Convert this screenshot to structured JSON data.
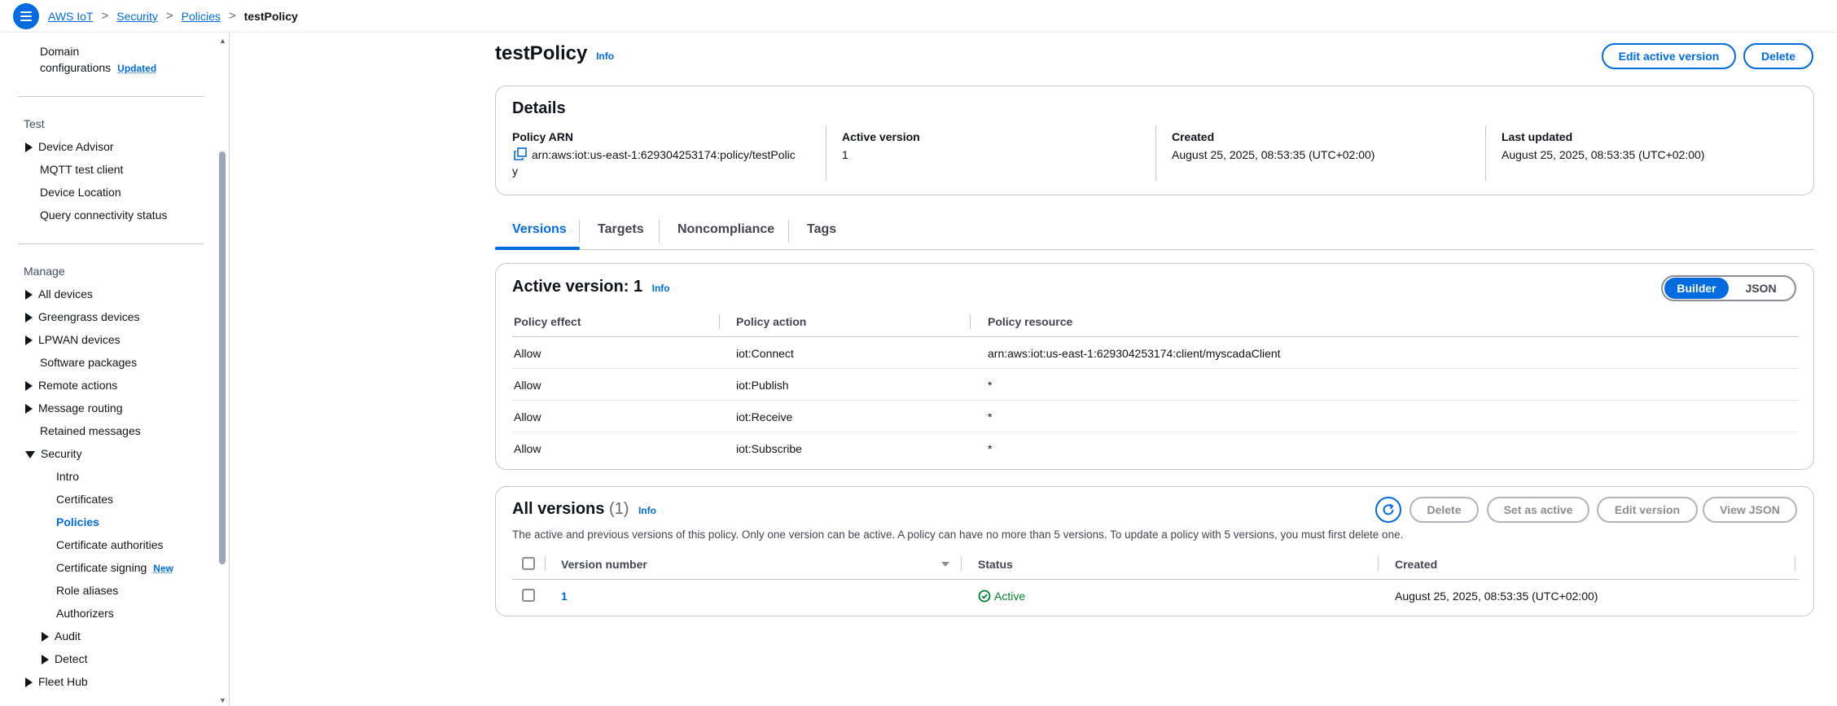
{
  "breadcrumb": {
    "items": [
      "AWS IoT",
      "Security",
      "Policies"
    ],
    "current": "testPolicy",
    "separator": ">"
  },
  "sidebar": {
    "domain_config_line1": "Domain",
    "domain_config_line2": "configurations",
    "domain_config_badge": "Updated",
    "test_heading": "Test",
    "test_items": [
      "Device Advisor",
      "MQTT test client",
      "Device Location",
      "Query connectivity status"
    ],
    "manage_heading": "Manage",
    "manage_items": [
      "All devices",
      "Greengrass devices",
      "LPWAN devices",
      "Software packages",
      "Remote actions",
      "Message routing",
      "Retained messages",
      "Security"
    ],
    "security_items": [
      "Intro",
      "Certificates",
      "Policies",
      "Certificate authorities",
      "Certificate signing",
      "Role aliases",
      "Authorizers",
      "Audit",
      "Detect"
    ],
    "certificate_signing_badge": "New",
    "fleet_hub": "Fleet Hub",
    "active_item": "Policies"
  },
  "page": {
    "title": "testPolicy",
    "info": "Info",
    "edit_active_version": "Edit active version",
    "delete": "Delete"
  },
  "details": {
    "heading": "Details",
    "policy_arn_label": "Policy ARN",
    "policy_arn_line1": "arn:aws:iot:us-east-1:629304253174:policy/testPolic",
    "policy_arn_line2": "y",
    "active_version_label": "Active version",
    "active_version_value": "1",
    "created_label": "Created",
    "created_value": "August 25, 2025, 08:53:35 (UTC+02:00)",
    "last_updated_label": "Last updated",
    "last_updated_value": "August 25, 2025, 08:53:35 (UTC+02:00)"
  },
  "tabs": [
    "Versions",
    "Targets",
    "Noncompliance",
    "Tags"
  ],
  "active_tab": "Versions",
  "active_version_panel": {
    "heading": "Active version: 1",
    "info": "Info",
    "toggle": [
      "Builder",
      "JSON"
    ],
    "toggle_selected": "Builder",
    "columns": [
      "Policy effect",
      "Policy action",
      "Policy resource"
    ],
    "rows": [
      [
        "Allow",
        "iot:Connect",
        "arn:aws:iot:us-east-1:629304253174:client/myscadaClient"
      ],
      [
        "Allow",
        "iot:Publish",
        "*"
      ],
      [
        "Allow",
        "iot:Receive",
        "*"
      ],
      [
        "Allow",
        "iot:Subscribe",
        "*"
      ]
    ]
  },
  "all_versions": {
    "heading": "All versions",
    "count": "(1)",
    "info": "Info",
    "description": "The active and previous versions of this policy. Only one version can be active. A policy can have no more than 5 versions. To update a policy with 5 versions, you must first delete one.",
    "buttons": [
      "Delete",
      "Set as active",
      "Edit version",
      "View JSON"
    ],
    "columns": [
      "Version number",
      "Status",
      "Created"
    ],
    "rows": [
      {
        "version": "1",
        "status": "Active",
        "created": "August 25, 2025, 08:53:35 (UTC+02:00)"
      }
    ]
  },
  "colors": {
    "accent": "#006ce0",
    "success": "#00802f",
    "border": "#c6c6cd"
  }
}
